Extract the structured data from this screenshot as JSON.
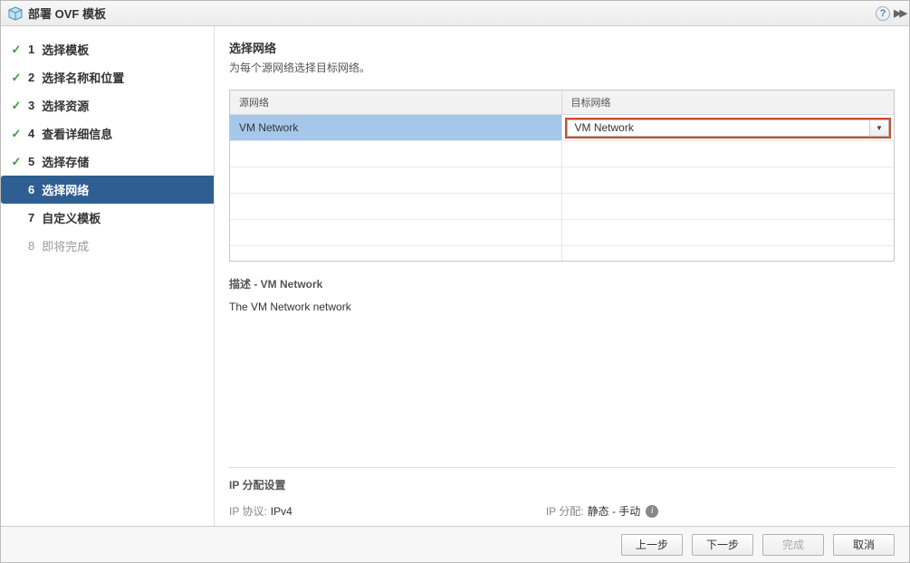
{
  "titlebar": {
    "title": "部署 OVF 模板"
  },
  "steps": [
    {
      "num": "1",
      "label": "选择模板",
      "state": "completed"
    },
    {
      "num": "2",
      "label": "选择名称和位置",
      "state": "completed"
    },
    {
      "num": "3",
      "label": "选择资源",
      "state": "completed"
    },
    {
      "num": "4",
      "label": "查看详细信息",
      "state": "completed"
    },
    {
      "num": "5",
      "label": "选择存储",
      "state": "completed"
    },
    {
      "num": "6",
      "label": "选择网络",
      "state": "current"
    },
    {
      "num": "7",
      "label": "自定义模板",
      "state": "future"
    },
    {
      "num": "8",
      "label": "即将完成",
      "state": "pending"
    }
  ],
  "main": {
    "heading": "选择网络",
    "subheading": "为每个源网络选择目标网络。",
    "columns": {
      "src": "源网络",
      "dst": "目标网络"
    },
    "rows": [
      {
        "src": "VM Network",
        "dst": "VM Network"
      }
    ],
    "emptyRows": 5,
    "description": {
      "title": "描述 - VM Network",
      "text": "The VM Network network"
    },
    "ip": {
      "heading": "IP 分配设置",
      "protoLabel": "IP 协议:",
      "protoValue": "IPv4",
      "allocLabel": "IP 分配:",
      "allocValue": "静态 - 手动"
    }
  },
  "footer": {
    "back": "上一步",
    "next": "下一步",
    "finish": "完成",
    "cancel": "取消"
  }
}
